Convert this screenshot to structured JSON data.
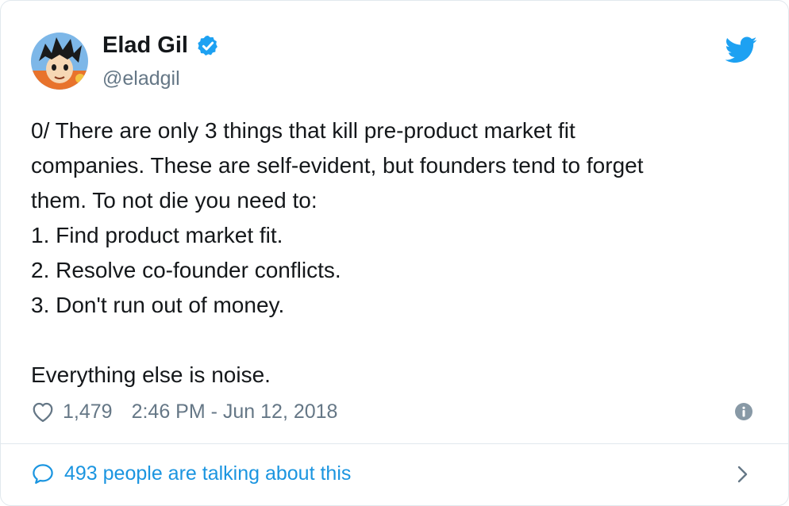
{
  "author": {
    "name": "Elad Gil",
    "handle": "@eladgil",
    "verified": true,
    "avatar_icon": "cartoon-avatar-icon"
  },
  "brand": {
    "icon": "twitter-bird-icon",
    "color": "#1da1f2"
  },
  "tweet": {
    "lines": [
      "0/ There are only 3 things that kill pre-product market fit",
      "companies. These are self-evident, but founders tend to forget",
      "them. To not die you need to:",
      "1. Find product market fit.",
      "2. Resolve co-founder conflicts.",
      "3. Don't run out of money."
    ],
    "closing": "Everything else is noise."
  },
  "meta": {
    "like_count": "1,479",
    "timestamp": "2:46 PM - Jun 12, 2018"
  },
  "conversation": {
    "label": "493 people are talking about this"
  },
  "colors": {
    "text": "#14171a",
    "secondary": "#657786",
    "link": "#1b95e0",
    "border": "#e1e8ed"
  }
}
